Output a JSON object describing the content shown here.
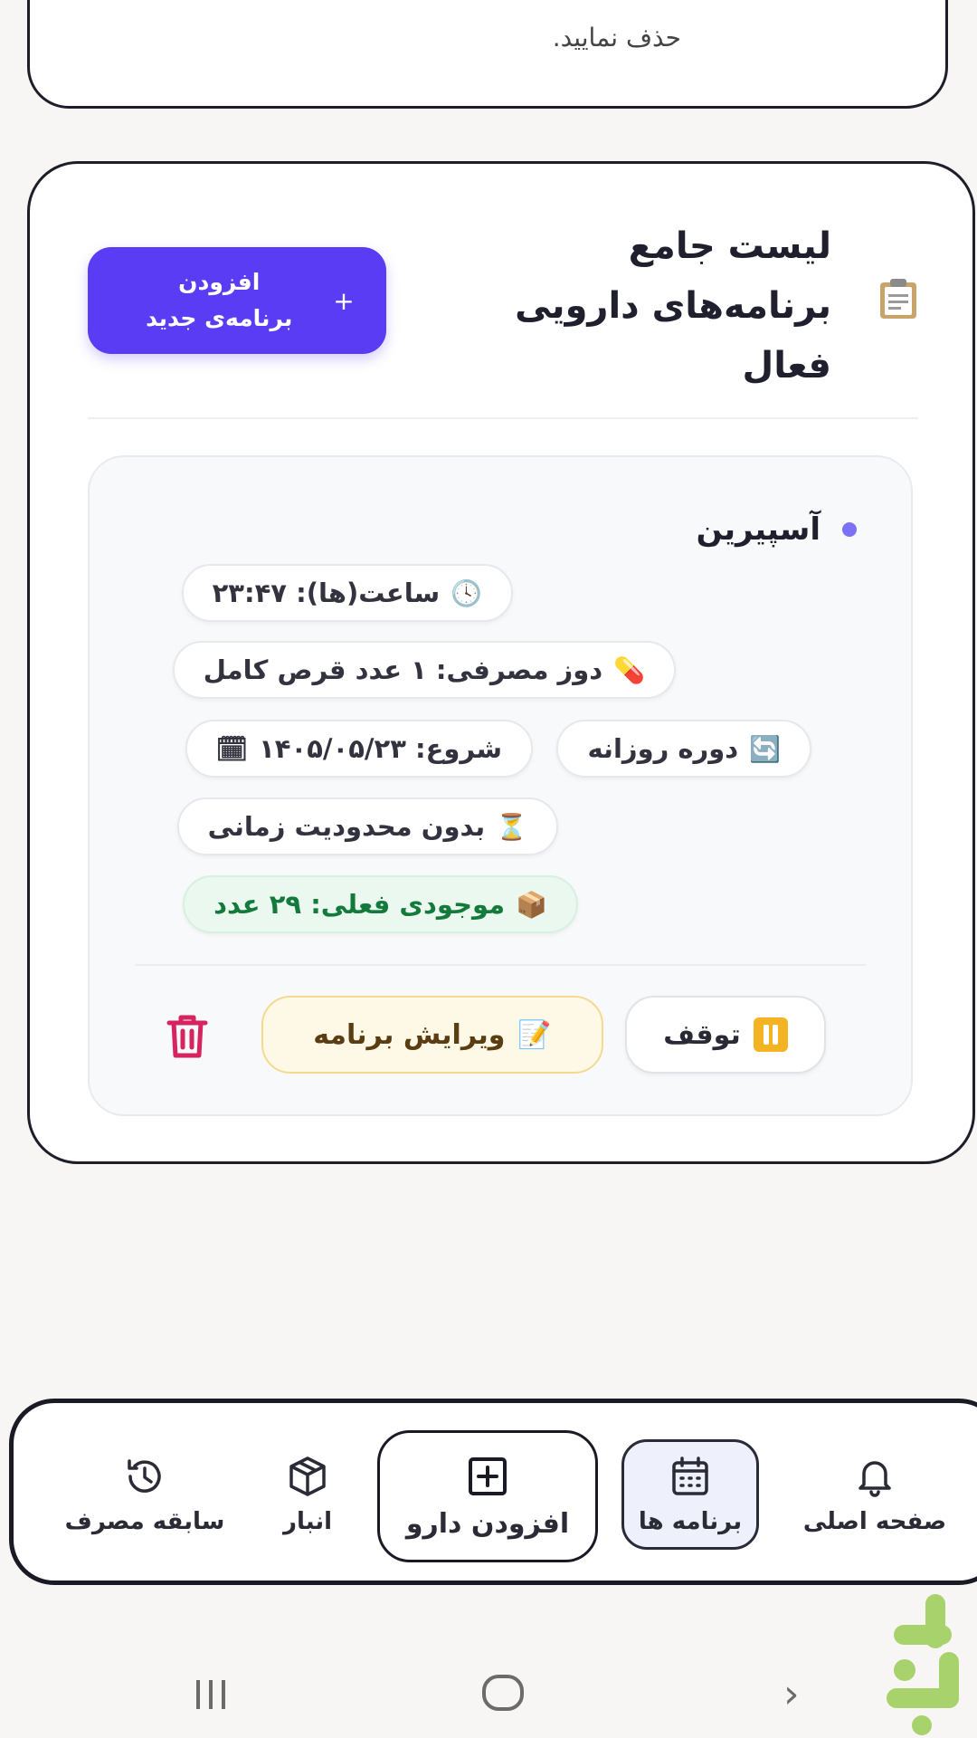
{
  "top_card": {
    "tail_text": "حذف نمایید."
  },
  "list_card": {
    "title_lines": [
      "لیست جامع",
      "برنامه‌های دارویی",
      "فعال"
    ],
    "add_button": {
      "label_line1": "افزودن",
      "label_line2": "برنامه‌ی جدید",
      "icon": "+"
    }
  },
  "medication": {
    "name": "آسپیرین",
    "chips": {
      "time": "ساعت(ها): ۲۳:۴۷",
      "dose": "دوز مصرفی: ۱ عدد قرص کامل",
      "cycle": "دوره روزانه",
      "start": "شروع: ۱۴۰۵/۰۵/۲۳",
      "duration": "بدون محدودیت زمانی",
      "stock": "موجودی فعلی: ۲۹ عدد"
    },
    "icons": {
      "time": "🕓",
      "dose": "💊",
      "cycle": "🔄",
      "start": "🗓",
      "duration": "⏳",
      "stock": "📦",
      "edit": "📝"
    },
    "actions": {
      "pause": "توقف",
      "edit": "ویرایش برنامه"
    }
  },
  "colors": {
    "primary": "#5b3cf5",
    "stock_green": "#147a3c",
    "delete_red": "#d6245f",
    "pause_yellow": "#f3b323"
  },
  "nav": {
    "home": "صفحه اصلی",
    "programs": "برنامه ها",
    "add_drug": "افزودن دارو",
    "store": "انبار",
    "history": "سابقه مصرف"
  }
}
